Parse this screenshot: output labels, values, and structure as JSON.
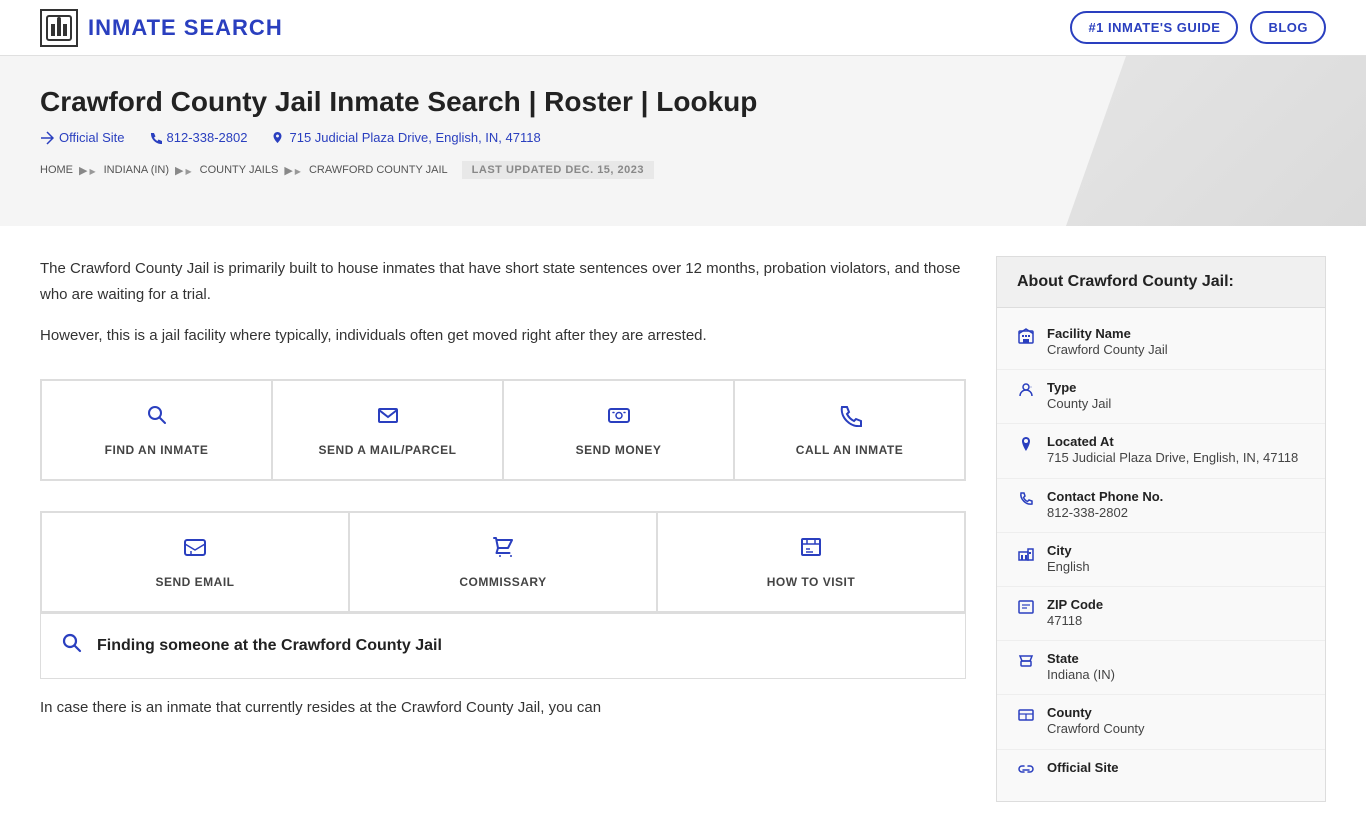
{
  "header": {
    "logo_text": "INMATE SEARCH",
    "btn_guide": "#1 INMATE'S GUIDE",
    "btn_blog": "BLOG"
  },
  "hero": {
    "title": "Crawford County Jail Inmate Search | Roster | Lookup",
    "official_site_label": "Official Site",
    "phone": "812-338-2802",
    "address": "715 Judicial Plaza Drive, English, IN, 47118",
    "breadcrumb": {
      "home": "HOME",
      "state": "INDIANA (IN)",
      "county_jails": "COUNTY JAILS",
      "current": "CRAWFORD COUNTY JAIL"
    },
    "last_updated": "LAST UPDATED DEC. 15, 2023"
  },
  "description": {
    "para1": "The Crawford County Jail is primarily built to house inmates that have short state sentences over 12 months, probation violators, and those who are waiting for a trial.",
    "para2": "However, this is a jail facility where typically, individuals often get moved right after they are arrested."
  },
  "actions": {
    "find_inmate": "FIND AN INMATE",
    "send_mail": "SEND A MAIL/PARCEL",
    "send_money": "SEND MONEY",
    "call_inmate": "CALL AN INMATE",
    "send_email": "SEND EMAIL",
    "commissary": "COMMISSARY",
    "how_to_visit": "HOW TO VISIT"
  },
  "find_section": {
    "heading": "Finding someone at the Crawford County Jail"
  },
  "bottom_text": "In case there is an inmate that currently resides at the Crawford County Jail, you can",
  "about": {
    "heading": "About Crawford County Jail:",
    "items": [
      {
        "label": "Facility Name",
        "value": "Crawford County Jail",
        "icon": "building"
      },
      {
        "label": "Type",
        "value": "County Jail",
        "icon": "person"
      },
      {
        "label": "Located At",
        "value": "715 Judicial Plaza Drive, English, IN, 47118",
        "icon": "location"
      },
      {
        "label": "Contact Phone No.",
        "value": "812-338-2802",
        "icon": "phone"
      },
      {
        "label": "City",
        "value": "English",
        "icon": "city"
      },
      {
        "label": "ZIP Code",
        "value": "47118",
        "icon": "zip"
      },
      {
        "label": "State",
        "value": "Indiana (IN)",
        "icon": "state"
      },
      {
        "label": "County",
        "value": "Crawford County",
        "icon": "county"
      },
      {
        "label": "Official Site",
        "value": "",
        "icon": "link"
      }
    ]
  }
}
